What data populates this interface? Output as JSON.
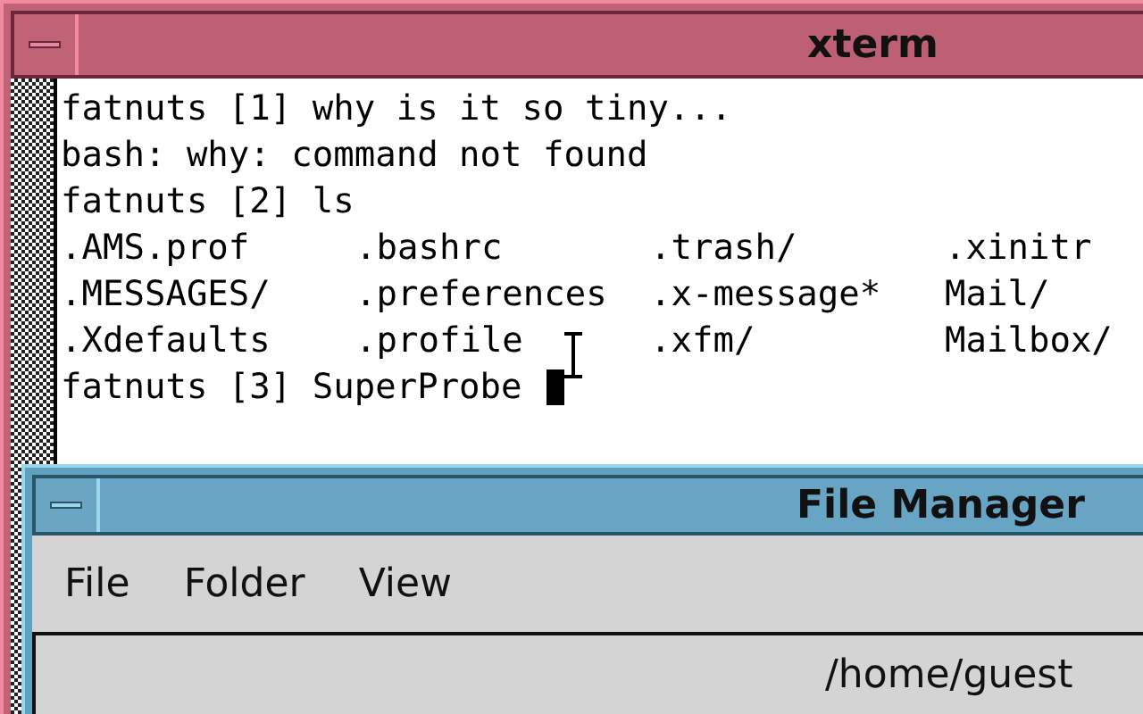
{
  "xterm": {
    "title": "xterm",
    "lines": [
      {
        "kind": "text",
        "text": "fatnuts [1] why is it so tiny..."
      },
      {
        "kind": "text",
        "text": "bash: why: command not found"
      },
      {
        "kind": "text",
        "text": "fatnuts [2] ls"
      },
      {
        "kind": "columns",
        "cells": [
          ".AMS.prof",
          ".bashrc",
          ".trash/",
          ".xinitr"
        ]
      },
      {
        "kind": "columns",
        "cells": [
          ".MESSAGES/",
          ".preferences",
          ".x-message*",
          "Mail/"
        ]
      },
      {
        "kind": "columns",
        "cells": [
          ".Xdefaults",
          ".profile",
          ".xfm/",
          "Mailbox/"
        ]
      },
      {
        "kind": "prompt",
        "text": "fatnuts [3] SuperProbe "
      }
    ]
  },
  "file_manager": {
    "title": "File Manager",
    "menu": [
      "File",
      "Folder",
      "View"
    ],
    "path": "/home/guest"
  }
}
